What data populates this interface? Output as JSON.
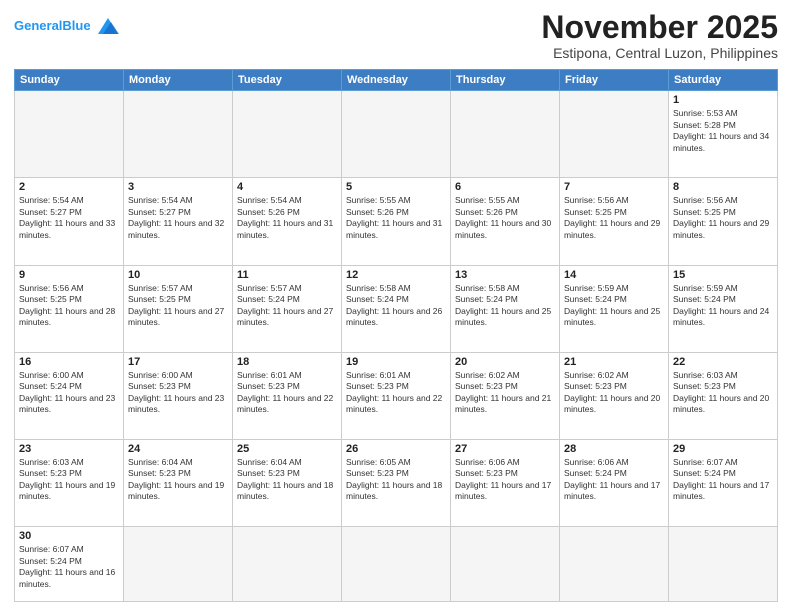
{
  "header": {
    "logo_general": "General",
    "logo_blue": "Blue",
    "month_title": "November 2025",
    "location": "Estipona, Central Luzon, Philippines"
  },
  "weekdays": [
    "Sunday",
    "Monday",
    "Tuesday",
    "Wednesday",
    "Thursday",
    "Friday",
    "Saturday"
  ],
  "days": {
    "d1": {
      "num": "1",
      "sunrise": "5:53 AM",
      "sunset": "5:28 PM",
      "daylight": "11 hours and 34 minutes."
    },
    "d2": {
      "num": "2",
      "sunrise": "5:54 AM",
      "sunset": "5:27 PM",
      "daylight": "11 hours and 33 minutes."
    },
    "d3": {
      "num": "3",
      "sunrise": "5:54 AM",
      "sunset": "5:27 PM",
      "daylight": "11 hours and 32 minutes."
    },
    "d4": {
      "num": "4",
      "sunrise": "5:54 AM",
      "sunset": "5:26 PM",
      "daylight": "11 hours and 31 minutes."
    },
    "d5": {
      "num": "5",
      "sunrise": "5:55 AM",
      "sunset": "5:26 PM",
      "daylight": "11 hours and 31 minutes."
    },
    "d6": {
      "num": "6",
      "sunrise": "5:55 AM",
      "sunset": "5:26 PM",
      "daylight": "11 hours and 30 minutes."
    },
    "d7": {
      "num": "7",
      "sunrise": "5:56 AM",
      "sunset": "5:25 PM",
      "daylight": "11 hours and 29 minutes."
    },
    "d8": {
      "num": "8",
      "sunrise": "5:56 AM",
      "sunset": "5:25 PM",
      "daylight": "11 hours and 29 minutes."
    },
    "d9": {
      "num": "9",
      "sunrise": "5:56 AM",
      "sunset": "5:25 PM",
      "daylight": "11 hours and 28 minutes."
    },
    "d10": {
      "num": "10",
      "sunrise": "5:57 AM",
      "sunset": "5:25 PM",
      "daylight": "11 hours and 27 minutes."
    },
    "d11": {
      "num": "11",
      "sunrise": "5:57 AM",
      "sunset": "5:24 PM",
      "daylight": "11 hours and 27 minutes."
    },
    "d12": {
      "num": "12",
      "sunrise": "5:58 AM",
      "sunset": "5:24 PM",
      "daylight": "11 hours and 26 minutes."
    },
    "d13": {
      "num": "13",
      "sunrise": "5:58 AM",
      "sunset": "5:24 PM",
      "daylight": "11 hours and 25 minutes."
    },
    "d14": {
      "num": "14",
      "sunrise": "5:59 AM",
      "sunset": "5:24 PM",
      "daylight": "11 hours and 25 minutes."
    },
    "d15": {
      "num": "15",
      "sunrise": "5:59 AM",
      "sunset": "5:24 PM",
      "daylight": "11 hours and 24 minutes."
    },
    "d16": {
      "num": "16",
      "sunrise": "6:00 AM",
      "sunset": "5:24 PM",
      "daylight": "11 hours and 23 minutes."
    },
    "d17": {
      "num": "17",
      "sunrise": "6:00 AM",
      "sunset": "5:23 PM",
      "daylight": "11 hours and 23 minutes."
    },
    "d18": {
      "num": "18",
      "sunrise": "6:01 AM",
      "sunset": "5:23 PM",
      "daylight": "11 hours and 22 minutes."
    },
    "d19": {
      "num": "19",
      "sunrise": "6:01 AM",
      "sunset": "5:23 PM",
      "daylight": "11 hours and 22 minutes."
    },
    "d20": {
      "num": "20",
      "sunrise": "6:02 AM",
      "sunset": "5:23 PM",
      "daylight": "11 hours and 21 minutes."
    },
    "d21": {
      "num": "21",
      "sunrise": "6:02 AM",
      "sunset": "5:23 PM",
      "daylight": "11 hours and 20 minutes."
    },
    "d22": {
      "num": "22",
      "sunrise": "6:03 AM",
      "sunset": "5:23 PM",
      "daylight": "11 hours and 20 minutes."
    },
    "d23": {
      "num": "23",
      "sunrise": "6:03 AM",
      "sunset": "5:23 PM",
      "daylight": "11 hours and 19 minutes."
    },
    "d24": {
      "num": "24",
      "sunrise": "6:04 AM",
      "sunset": "5:23 PM",
      "daylight": "11 hours and 19 minutes."
    },
    "d25": {
      "num": "25",
      "sunrise": "6:04 AM",
      "sunset": "5:23 PM",
      "daylight": "11 hours and 18 minutes."
    },
    "d26": {
      "num": "26",
      "sunrise": "6:05 AM",
      "sunset": "5:23 PM",
      "daylight": "11 hours and 18 minutes."
    },
    "d27": {
      "num": "27",
      "sunrise": "6:06 AM",
      "sunset": "5:23 PM",
      "daylight": "11 hours and 17 minutes."
    },
    "d28": {
      "num": "28",
      "sunrise": "6:06 AM",
      "sunset": "5:24 PM",
      "daylight": "11 hours and 17 minutes."
    },
    "d29": {
      "num": "29",
      "sunrise": "6:07 AM",
      "sunset": "5:24 PM",
      "daylight": "11 hours and 17 minutes."
    },
    "d30": {
      "num": "30",
      "sunrise": "6:07 AM",
      "sunset": "5:24 PM",
      "daylight": "11 hours and 16 minutes."
    }
  },
  "labels": {
    "sunrise": "Sunrise:",
    "sunset": "Sunset:",
    "daylight": "Daylight:"
  }
}
